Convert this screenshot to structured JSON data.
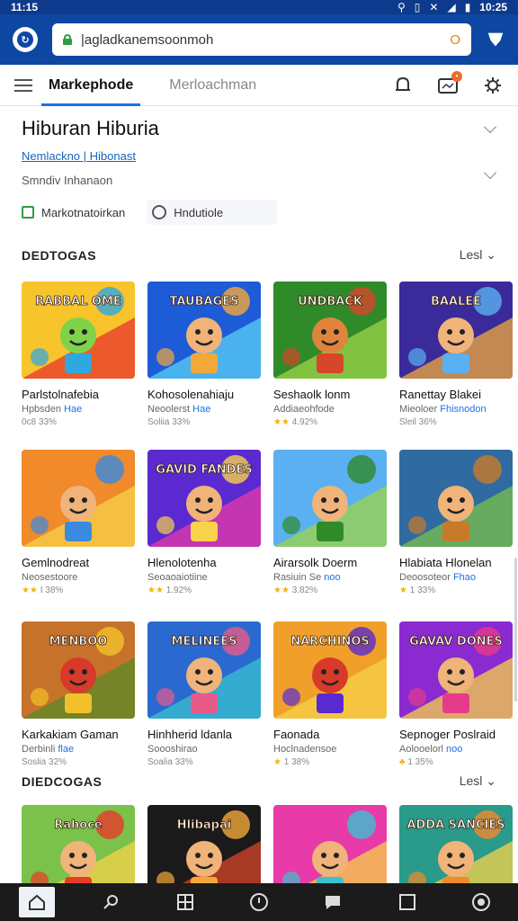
{
  "status_bar": {
    "time_left": "11:15",
    "time_right": "10:25"
  },
  "address_bar": {
    "url": "|agladkanemsoonmoh",
    "reload": "O"
  },
  "tabs": {
    "active": "Markephode",
    "inactive": "Merloachman"
  },
  "header": {
    "title": "Hiburan Hiburia",
    "subtitle_link": "Nemlackno | Hibonast",
    "description": "Smndiv Inhanaon",
    "option_check_label": "Markotnatoirkan",
    "option_radio_label": "Hndutiole"
  },
  "sections": [
    {
      "title": "DEDTOGAS",
      "more": "Lesl"
    },
    {
      "title": "DIEDCOGAS",
      "more": "Lesl"
    }
  ],
  "games_row1": [
    {
      "name": "Parlstolnafebia",
      "dev": "Hpbsden",
      "dev_hl": "Hae",
      "stars": "",
      "rating": "0c8 33%",
      "thumb_text": "RABBAL OME",
      "c1": "#f7c42c",
      "c2": "#e8352c",
      "c3": "#2fa7e0",
      "fig": "#7fd24a"
    },
    {
      "name": "Kohosolenahiaju",
      "dev": "Neoolerst",
      "dev_hl": "Hae",
      "stars": "",
      "rating": "Soliia 33%",
      "thumb_text": "TAUBAGES",
      "c1": "#1e5bd6",
      "c2": "#5ad0f5",
      "c3": "#f2a93a",
      "fig": "#f0b37a"
    },
    {
      "name": "Seshaolk lonm",
      "dev": "Addiaeohfode",
      "dev_hl": "",
      "stars": "★★",
      "rating": "4.92%",
      "thumb_text": "UNDBACK",
      "c1": "#2f8a2a",
      "c2": "#9fd44a",
      "c3": "#d7452a",
      "fig": "#e0843c"
    },
    {
      "name": "Ranettay Blakei",
      "dev": "Mieoloer",
      "dev_hl": "Fhisnodon",
      "stars": "",
      "rating": "Sleil 36%",
      "thumb_text": "BAALEE",
      "c1": "#3a2a9a",
      "c2": "#f2a93a",
      "c3": "#5ab0f0",
      "fig": "#f0b37a"
    }
  ],
  "games_row2": [
    {
      "name": "Gemlnodreat",
      "dev": "Neosestoore",
      "dev_hl": "",
      "stars": "★★",
      "rating": "I 38%",
      "thumb_text": "",
      "c1": "#f08a2a",
      "c2": "#f7d24a",
      "c3": "#3a8ae0",
      "fig": "#f0b37a"
    },
    {
      "name": "Hlenolotenha",
      "dev": "Seoaoaiotiine",
      "dev_hl": "",
      "stars": "★★",
      "rating": "1.92%",
      "thumb_text": "GAVID FANDES",
      "c1": "#5a2ad0",
      "c2": "#e83aa8",
      "c3": "#f7d24a",
      "fig": "#f0b37a"
    },
    {
      "name": "Airarsolk Doerm",
      "dev": "Rasiuin Se",
      "dev_hl": "noo",
      "stars": "★★",
      "rating": "3.82%",
      "thumb_text": "",
      "c1": "#5ab0f0",
      "c2": "#9fd44a",
      "c3": "#2f8a2a",
      "fig": "#f0b37a"
    },
    {
      "name": "Hlabiata Hlonelan",
      "dev": "Deoosoteor",
      "dev_hl": "Fhao",
      "stars": "★",
      "rating": "1 33%",
      "thumb_text": "",
      "c1": "#2f6aa0",
      "c2": "#7ac24a",
      "c3": "#c77a2a",
      "fig": "#f0b37a"
    }
  ],
  "games_row3": [
    {
      "name": "Karkakiam Gaman",
      "dev": "Derbinli",
      "dev_hl": "flae",
      "stars": "",
      "rating": "Soslia 32%",
      "thumb_text": "MENBOO",
      "c1": "#c7722a",
      "c2": "#5a8a2a",
      "c3": "#f2c02a",
      "fig": "#d73a2a"
    },
    {
      "name": "Hinhherid ldanla",
      "dev": "Soooshirao",
      "dev_hl": "",
      "stars": "",
      "rating": "Soalia 33%",
      "thumb_text": "MELINEES",
      "c1": "#2a6ad0",
      "c2": "#3ac2d0",
      "c3": "#e85a8a",
      "fig": "#f0b37a"
    },
    {
      "name": "Faonada",
      "dev": "Hoclnadensoe",
      "dev_hl": "",
      "stars": "★",
      "rating": "1 38%",
      "thumb_text": "NARCHINOS",
      "c1": "#f0a02a",
      "c2": "#f7d24a",
      "c3": "#5a2ad0",
      "fig": "#d73a2a"
    },
    {
      "name": "Sepnoger Poslraid",
      "dev": "Aolooelorl",
      "dev_hl": "noo",
      "stars": "♣",
      "rating": "1 35%",
      "thumb_text": "GAVAV DONES",
      "c1": "#8a2ad0",
      "c2": "#f7d24a",
      "c3": "#e83a8a",
      "fig": "#f0b37a"
    }
  ],
  "games_row4": [
    {
      "thumb_text": "Rahoce",
      "c1": "#7ac24a",
      "c2": "#f7d24a",
      "c3": "#e83a2a",
      "fig": "#f0b37a"
    },
    {
      "thumb_text": "Hlibapai",
      "c1": "#1a1a1a",
      "c2": "#d7452a",
      "c3": "#f2a93a",
      "fig": "#f0b37a"
    },
    {
      "thumb_text": "",
      "c1": "#e83aa8",
      "c2": "#f7d24a",
      "c3": "#3ac2d0",
      "fig": "#f0b37a"
    },
    {
      "thumb_text": "ADDA SANCIES",
      "c1": "#2a9a8a",
      "c2": "#f7d24a",
      "c3": "#f08a2a",
      "fig": "#f0b37a"
    }
  ],
  "colors": {
    "accent": "#1a73e8",
    "header_bg": "#0d47a1",
    "nav_bg": "#1b1b1b"
  }
}
